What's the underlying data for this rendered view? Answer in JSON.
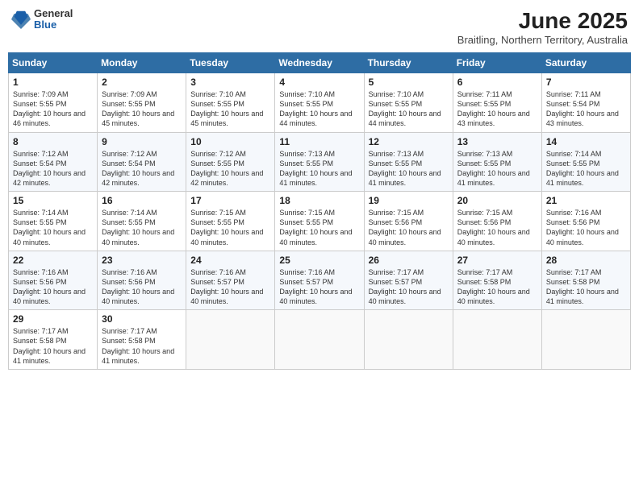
{
  "header": {
    "logo": {
      "general": "General",
      "blue": "Blue"
    },
    "title": "June 2025",
    "subtitle": "Braitling, Northern Territory, Australia"
  },
  "calendar": {
    "weekdays": [
      "Sunday",
      "Monday",
      "Tuesday",
      "Wednesday",
      "Thursday",
      "Friday",
      "Saturday"
    ],
    "weeks": [
      [
        {
          "day": "1",
          "sunrise": "7:09 AM",
          "sunset": "5:55 PM",
          "daylight": "10 hours and 46 minutes."
        },
        {
          "day": "2",
          "sunrise": "7:09 AM",
          "sunset": "5:55 PM",
          "daylight": "10 hours and 45 minutes."
        },
        {
          "day": "3",
          "sunrise": "7:10 AM",
          "sunset": "5:55 PM",
          "daylight": "10 hours and 45 minutes."
        },
        {
          "day": "4",
          "sunrise": "7:10 AM",
          "sunset": "5:55 PM",
          "daylight": "10 hours and 44 minutes."
        },
        {
          "day": "5",
          "sunrise": "7:10 AM",
          "sunset": "5:55 PM",
          "daylight": "10 hours and 44 minutes."
        },
        {
          "day": "6",
          "sunrise": "7:11 AM",
          "sunset": "5:55 PM",
          "daylight": "10 hours and 43 minutes."
        },
        {
          "day": "7",
          "sunrise": "7:11 AM",
          "sunset": "5:54 PM",
          "daylight": "10 hours and 43 minutes."
        }
      ],
      [
        {
          "day": "8",
          "sunrise": "7:12 AM",
          "sunset": "5:54 PM",
          "daylight": "10 hours and 42 minutes."
        },
        {
          "day": "9",
          "sunrise": "7:12 AM",
          "sunset": "5:54 PM",
          "daylight": "10 hours and 42 minutes."
        },
        {
          "day": "10",
          "sunrise": "7:12 AM",
          "sunset": "5:55 PM",
          "daylight": "10 hours and 42 minutes."
        },
        {
          "day": "11",
          "sunrise": "7:13 AM",
          "sunset": "5:55 PM",
          "daylight": "10 hours and 41 minutes."
        },
        {
          "day": "12",
          "sunrise": "7:13 AM",
          "sunset": "5:55 PM",
          "daylight": "10 hours and 41 minutes."
        },
        {
          "day": "13",
          "sunrise": "7:13 AM",
          "sunset": "5:55 PM",
          "daylight": "10 hours and 41 minutes."
        },
        {
          "day": "14",
          "sunrise": "7:14 AM",
          "sunset": "5:55 PM",
          "daylight": "10 hours and 41 minutes."
        }
      ],
      [
        {
          "day": "15",
          "sunrise": "7:14 AM",
          "sunset": "5:55 PM",
          "daylight": "10 hours and 40 minutes."
        },
        {
          "day": "16",
          "sunrise": "7:14 AM",
          "sunset": "5:55 PM",
          "daylight": "10 hours and 40 minutes."
        },
        {
          "day": "17",
          "sunrise": "7:15 AM",
          "sunset": "5:55 PM",
          "daylight": "10 hours and 40 minutes."
        },
        {
          "day": "18",
          "sunrise": "7:15 AM",
          "sunset": "5:55 PM",
          "daylight": "10 hours and 40 minutes."
        },
        {
          "day": "19",
          "sunrise": "7:15 AM",
          "sunset": "5:56 PM",
          "daylight": "10 hours and 40 minutes."
        },
        {
          "day": "20",
          "sunrise": "7:15 AM",
          "sunset": "5:56 PM",
          "daylight": "10 hours and 40 minutes."
        },
        {
          "day": "21",
          "sunrise": "7:16 AM",
          "sunset": "5:56 PM",
          "daylight": "10 hours and 40 minutes."
        }
      ],
      [
        {
          "day": "22",
          "sunrise": "7:16 AM",
          "sunset": "5:56 PM",
          "daylight": "10 hours and 40 minutes."
        },
        {
          "day": "23",
          "sunrise": "7:16 AM",
          "sunset": "5:56 PM",
          "daylight": "10 hours and 40 minutes."
        },
        {
          "day": "24",
          "sunrise": "7:16 AM",
          "sunset": "5:57 PM",
          "daylight": "10 hours and 40 minutes."
        },
        {
          "day": "25",
          "sunrise": "7:16 AM",
          "sunset": "5:57 PM",
          "daylight": "10 hours and 40 minutes."
        },
        {
          "day": "26",
          "sunrise": "7:17 AM",
          "sunset": "5:57 PM",
          "daylight": "10 hours and 40 minutes."
        },
        {
          "day": "27",
          "sunrise": "7:17 AM",
          "sunset": "5:58 PM",
          "daylight": "10 hours and 40 minutes."
        },
        {
          "day": "28",
          "sunrise": "7:17 AM",
          "sunset": "5:58 PM",
          "daylight": "10 hours and 41 minutes."
        }
      ],
      [
        {
          "day": "29",
          "sunrise": "7:17 AM",
          "sunset": "5:58 PM",
          "daylight": "10 hours and 41 minutes."
        },
        {
          "day": "30",
          "sunrise": "7:17 AM",
          "sunset": "5:58 PM",
          "daylight": "10 hours and 41 minutes."
        },
        null,
        null,
        null,
        null,
        null
      ]
    ]
  }
}
